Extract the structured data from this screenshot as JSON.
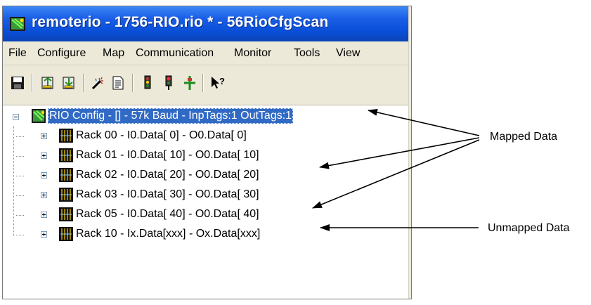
{
  "window": {
    "title": "remoterio - 1756-RIO.rio * - 56RioCfgScan"
  },
  "menu": [
    "File",
    "Configure",
    "Map",
    "Communication",
    "Monitor",
    "Tools",
    "View"
  ],
  "toolbar": {
    "buttons": [
      "save-icon",
      "upload-icon",
      "download-icon",
      "wand-icon",
      "document-icon",
      "traffic-light-icon",
      "signal-red-icon",
      "network-icon",
      "help-pointer-icon"
    ]
  },
  "tree": {
    "root": "RIO Config - [] - 57k Baud - InpTags:1 OutTags:1",
    "racks": [
      "Rack 00 - I0.Data[ 0] - O0.Data[ 0]",
      "Rack 01 - I0.Data[ 10] - O0.Data[ 10]",
      "Rack 02 - I0.Data[ 20] - O0.Data[ 20]",
      "Rack 03 - I0.Data[ 30] - O0.Data[ 30]",
      "Rack 05 - I0.Data[ 40] - O0.Data[ 40]",
      "Rack 10 - Ix.Data[xxx] - Ox.Data[xxx]"
    ]
  },
  "callouts": {
    "mapped": "Mapped Data",
    "unmapped": "Unmapped Data"
  },
  "colors": {
    "titlebar": "#0a4fd8",
    "selection": "#316ac5",
    "chrome": "#ece9d8"
  }
}
